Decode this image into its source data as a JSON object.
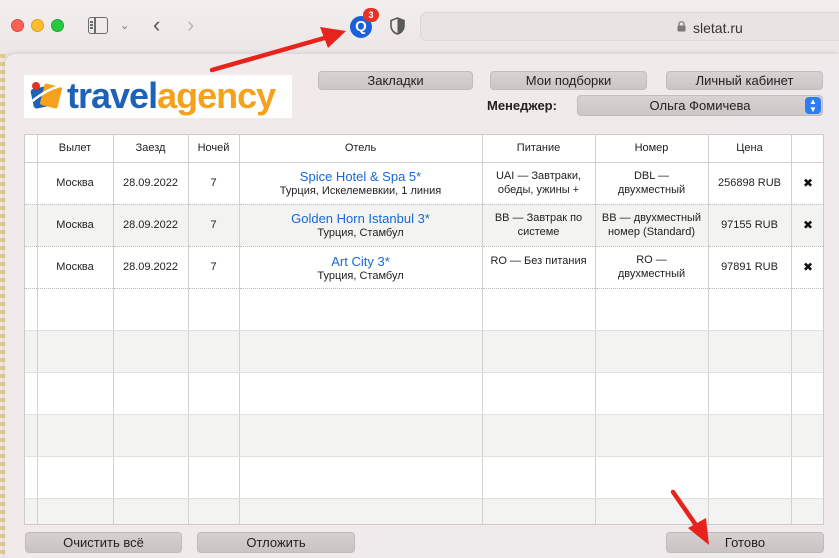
{
  "browser": {
    "url": "sletat.ru",
    "extension_badge": "3",
    "extension_letter": "Q"
  },
  "logo": {
    "word_part1": "travel",
    "word_part2": "agency",
    "color_primary": "#1d62b6",
    "color_secondary": "#f4a11b"
  },
  "toolbar": {
    "bookmarks_label": "Закладки",
    "picks_label": "Мои подборки",
    "account_label": "Личный кабинет"
  },
  "manager": {
    "label": "Менеджер:",
    "selected": "Ольга Фомичева"
  },
  "table": {
    "headers": {
      "departure": "Вылет",
      "checkin": "Заезд",
      "nights": "Ночей",
      "hotel": "Отель",
      "meals": "Питание",
      "room": "Номер",
      "price": "Цена"
    },
    "rows": [
      {
        "departure": "Москва",
        "checkin": "28.09.2022",
        "nights": "7",
        "hotel_name": "Spice Hotel & Spa 5*",
        "hotel_location": "Турция, Искелемевкии, 1 линия",
        "meals_line1": "UAI — Завтраки,",
        "meals_line2": "обеды, ужины +",
        "room_line1": "DBL —",
        "room_line2": "двухместный",
        "price": "256898 RUB",
        "delete": "✖"
      },
      {
        "departure": "Москва",
        "checkin": "28.09.2022",
        "nights": "7",
        "hotel_name": "Golden Horn Istanbul 3*",
        "hotel_location": "Турция, Стамбул",
        "meals_line1": "BB — Завтрак по",
        "meals_line2": "системе",
        "room_line1": "BB — двухместный",
        "room_line2": "номер (Standard)",
        "price": "97155 RUB",
        "delete": "✖"
      },
      {
        "departure": "Москва",
        "checkin": "28.09.2022",
        "nights": "7",
        "hotel_name": "Art City 3*",
        "hotel_location": "Турция, Стамбул",
        "meals_line1": "RO — Без питания",
        "meals_line2": "",
        "room_line1": "RO —",
        "room_line2": "двухместный",
        "price": "97891 RUB",
        "delete": "✖"
      }
    ]
  },
  "footer": {
    "clear_label": "Очистить всё",
    "defer_label": "Отложить",
    "done_label": "Готово"
  },
  "colors": {
    "link": "#1469d6",
    "annotation_arrow": "#e8231b",
    "select_accent": "#2d7cf2"
  }
}
